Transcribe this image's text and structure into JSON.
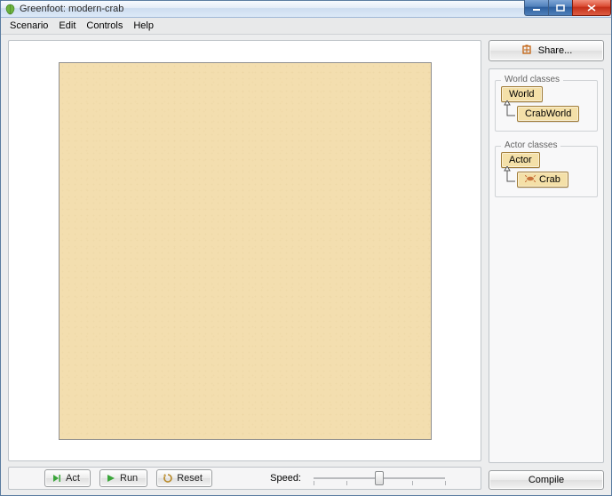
{
  "window": {
    "title": "Greenfoot: modern-crab"
  },
  "menu": {
    "items": [
      "Scenario",
      "Edit",
      "Controls",
      "Help"
    ]
  },
  "controls": {
    "act": "Act",
    "run": "Run",
    "reset": "Reset",
    "speed_label": "Speed:",
    "speed_value": 50
  },
  "share": {
    "label": "Share..."
  },
  "classes": {
    "world": {
      "legend": "World classes",
      "root": "World",
      "child": "CrabWorld"
    },
    "actor": {
      "legend": "Actor classes",
      "root": "Actor",
      "child": "Crab"
    }
  },
  "compile": {
    "label": "Compile"
  }
}
